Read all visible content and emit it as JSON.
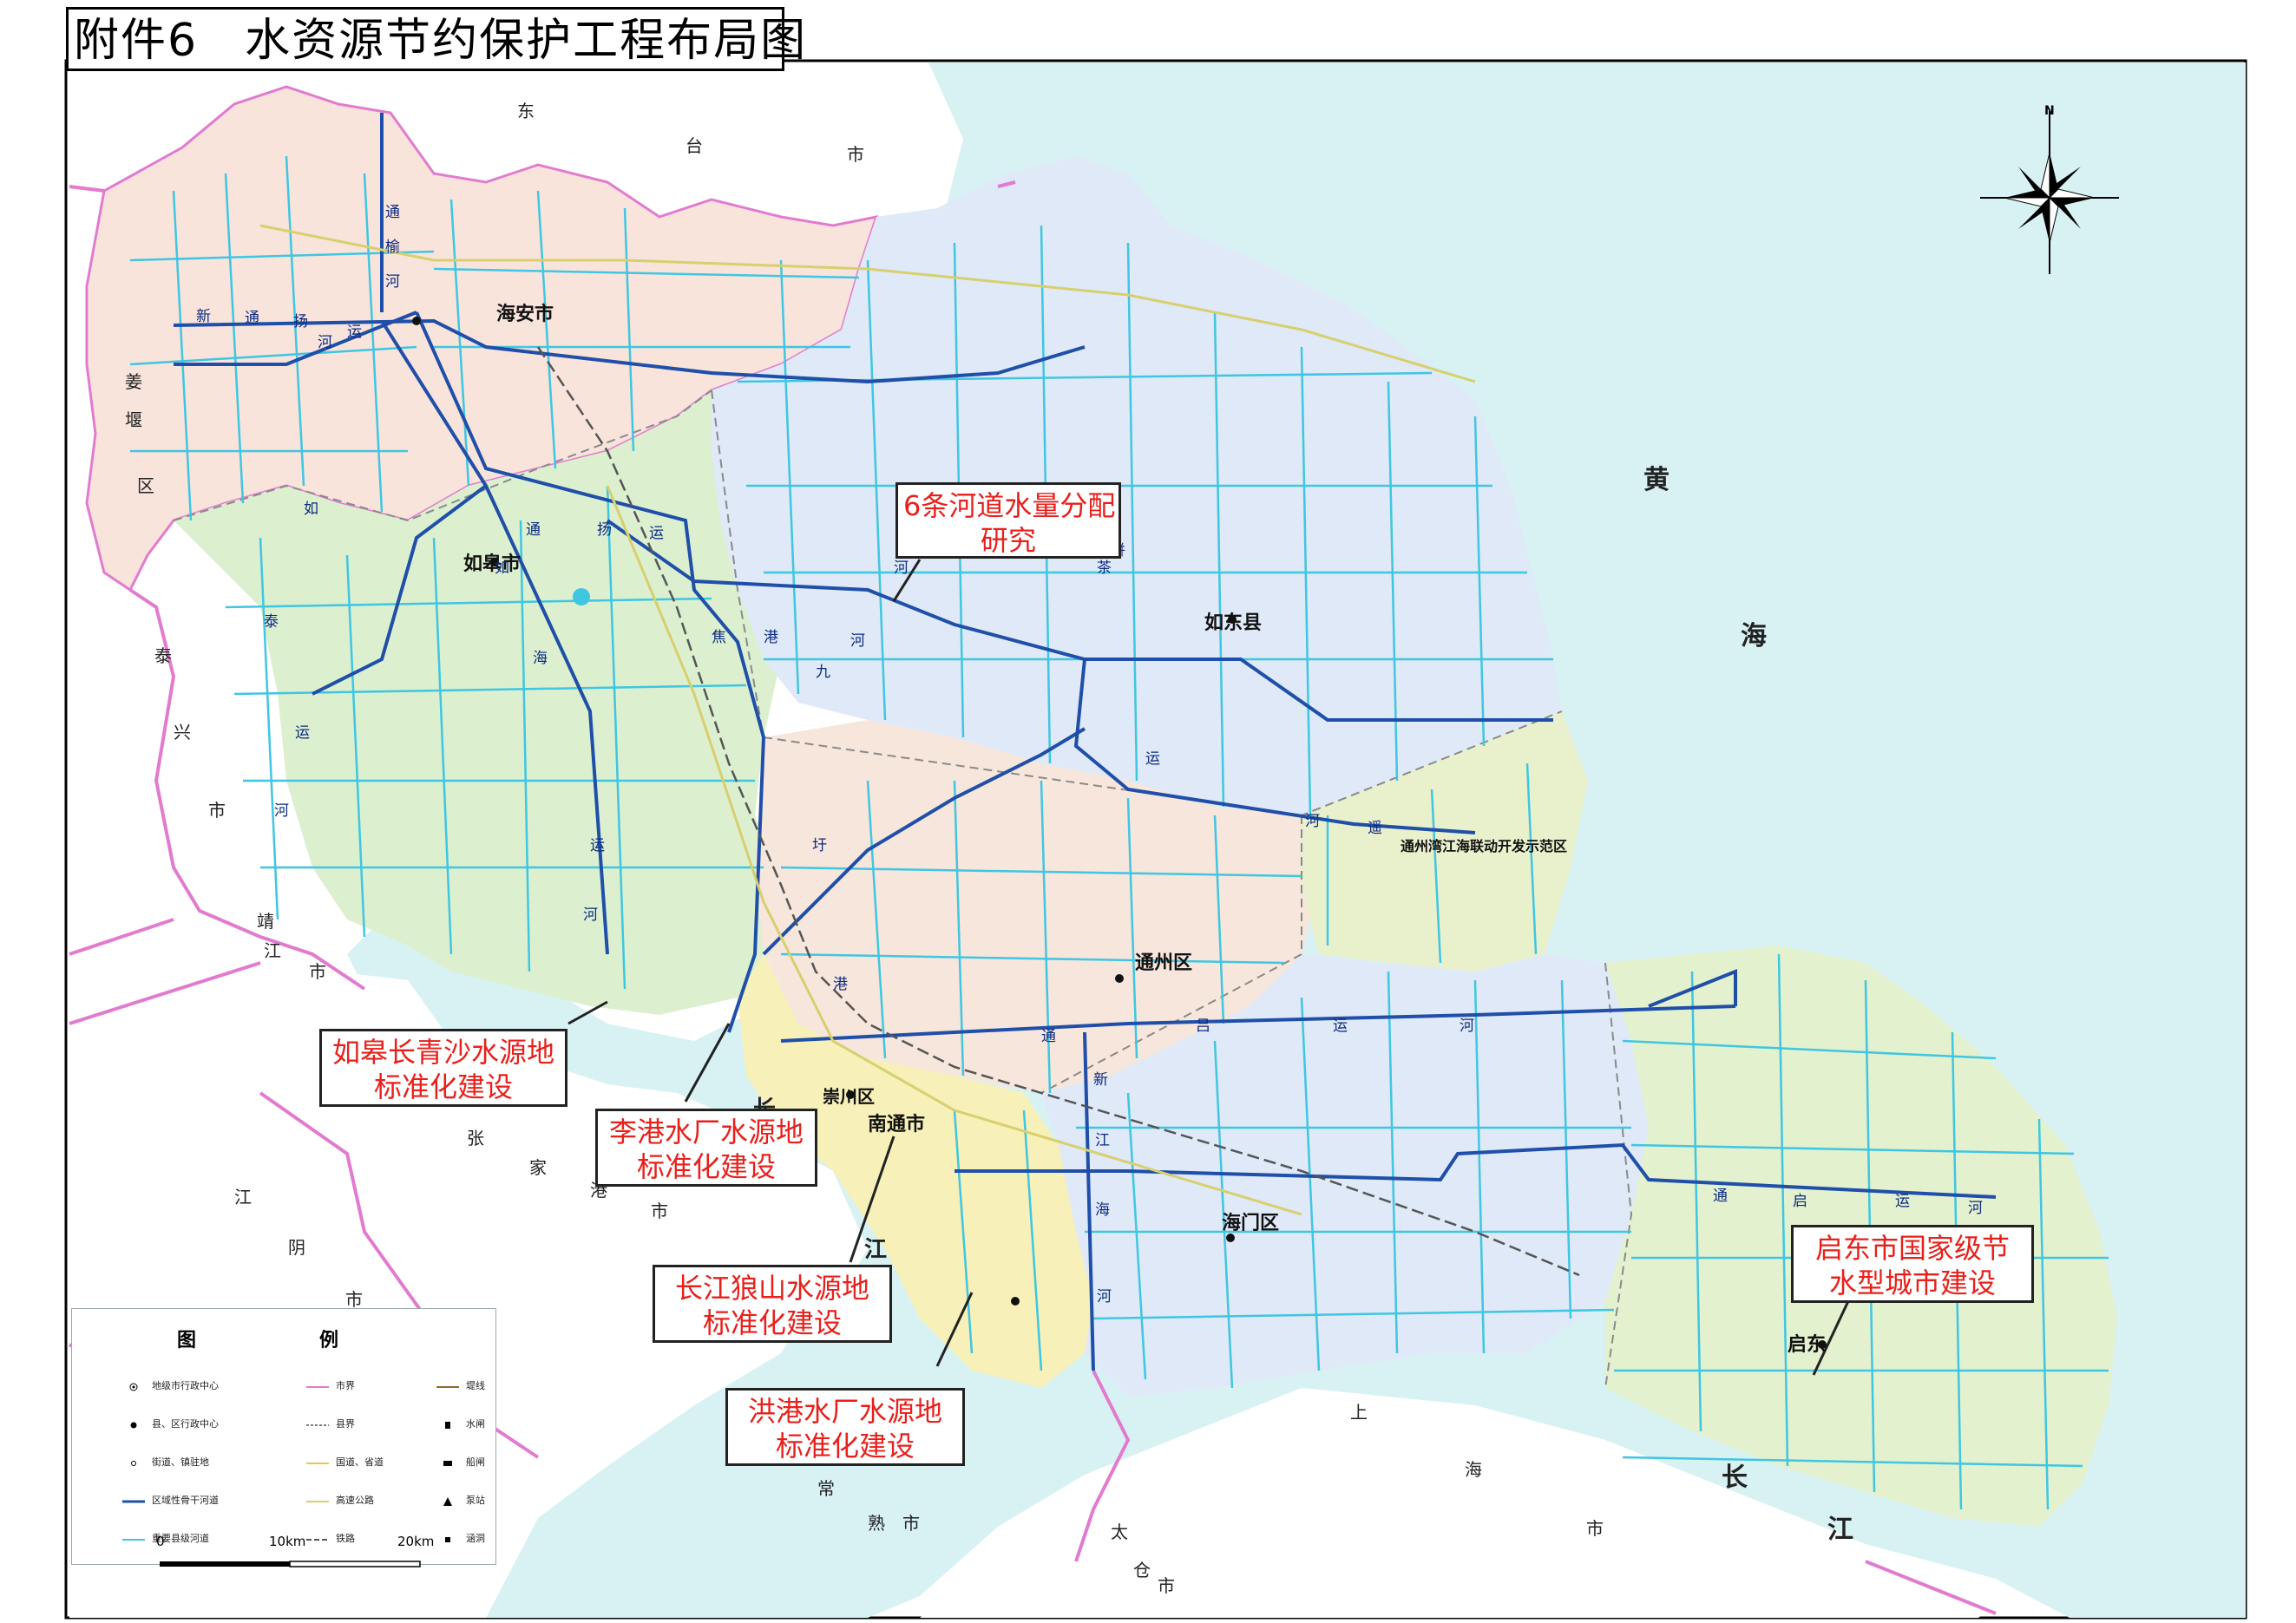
{
  "title": "附件6　水资源节约保护工程布局图",
  "callouts": {
    "river_allocation": [
      "6条河道水量分配",
      "研究"
    ],
    "rugao": [
      "如皋长青沙水源地",
      "标准化建设"
    ],
    "ligang": [
      "李港水厂水源地",
      "标准化建设"
    ],
    "langshan": [
      "长江狼山水源地",
      "标准化建设"
    ],
    "honggang": [
      "洪港水厂水源地",
      "标准化建设"
    ],
    "qidong": [
      "启东市国家级节",
      "水型城市建设"
    ]
  },
  "cities": {
    "haian": "海安市",
    "rugao": "如皋市",
    "rudong": "如东县",
    "tongzhou": "通州区",
    "chongchuan": "崇川区",
    "nantong": "南通市",
    "haimen": "海门区",
    "qidong": "启东",
    "tongzhouwan": "通州湾江海联动开发示范区"
  },
  "seas": {
    "huang": "黄",
    "hai": "海",
    "chang": "长",
    "jiang": "江"
  },
  "neighbors": {
    "dongtai": [
      "东",
      "台",
      "市"
    ],
    "jiangyan": [
      "姜",
      "堰",
      "区"
    ],
    "taixing": [
      "泰",
      "兴",
      "市"
    ],
    "jingjiang": [
      "靖",
      "江",
      "市"
    ],
    "zhangjiagang": [
      "张",
      "家",
      "港",
      "市"
    ],
    "jiangyin": [
      "江",
      "阴",
      "市"
    ],
    "changshu": [
      "常",
      "熟",
      "市"
    ],
    "taicang": [
      "太",
      "仓",
      "市"
    ],
    "shanghai": [
      "上",
      "海",
      "市"
    ]
  },
  "river_labels": [
    "通",
    "榆",
    "河",
    "新",
    "通",
    "扬",
    "运",
    "河",
    "如",
    "泰",
    "运",
    "河",
    "通",
    "扬",
    "运",
    "河",
    "九",
    "圩",
    "港",
    "如",
    "海",
    "运",
    "河",
    "新",
    "江",
    "海",
    "河",
    "通",
    "吕",
    "运",
    "河",
    "通",
    "启",
    "运",
    "河",
    "焦",
    "港",
    "河",
    "栟",
    "茶",
    "运",
    "河",
    "遥",
    "望",
    "港"
  ],
  "compass": {
    "north_label": "N"
  },
  "legend": {
    "title": "图　例",
    "items": [
      {
        "label": "地级市行政中心",
        "symbol": "capital"
      },
      {
        "label": "县、区行政中心",
        "symbol": "county"
      },
      {
        "label": "街道、镇驻地",
        "symbol": "town"
      },
      {
        "label": "区域性骨干河道",
        "symbol": "river-main"
      },
      {
        "label": "重要县级河道",
        "symbol": "river-county"
      },
      {
        "label": "市界",
        "symbol": "bnd-city"
      },
      {
        "label": "县界",
        "symbol": "bnd-county"
      },
      {
        "label": "国道、省道",
        "symbol": "road-national"
      },
      {
        "label": "高速公路",
        "symbol": "expressway"
      },
      {
        "label": "铁路",
        "symbol": "railway"
      },
      {
        "label": "堤线",
        "symbol": "dike"
      },
      {
        "label": "水闸",
        "symbol": "sluice"
      },
      {
        "label": "船闸",
        "symbol": "shiplock"
      },
      {
        "label": "泵站",
        "symbol": "pump"
      },
      {
        "label": "涵洞",
        "symbol": "culvert"
      }
    ]
  },
  "scale": {
    "labels": [
      "0",
      "10km",
      "20km"
    ]
  },
  "colors": {
    "sea": "#d8f2f4",
    "haian": "#f9e4dc",
    "rugao": "#dcf0d0",
    "rudong": "#dfe9f7",
    "tongzhou": "#f7e6dc",
    "chongchuan": "#f7f0b8",
    "haimen": "#dfe9f7",
    "qidong": "#e4f1cf",
    "tongzhouwan": "#e9f1cc",
    "main_river": "#1f4fa8",
    "county_river": "#3fc6e2",
    "city_boundary": "#e27bd0",
    "callout_text": "#e8201b"
  }
}
